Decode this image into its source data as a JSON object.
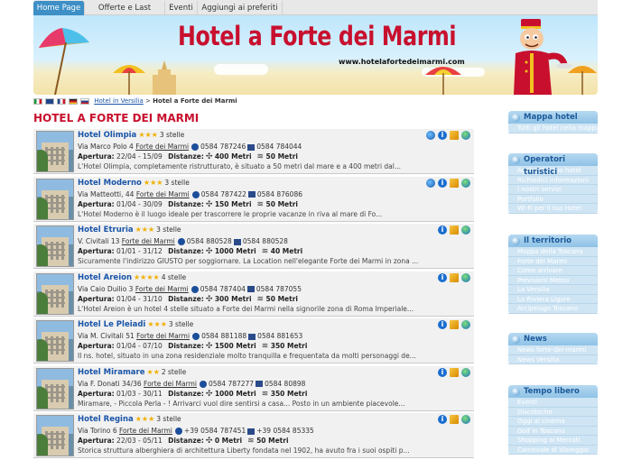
{
  "nav": {
    "tabs": [
      {
        "label": "Home Page"
      },
      {
        "label": "Offerte e Last Minute"
      },
      {
        "label": "Eventi"
      },
      {
        "label": "Aggiungi ai preferiti"
      }
    ]
  },
  "banner": {
    "title": "Hotel a Forte dei Marmi",
    "url": "www.hotelafortedeimarmi.com"
  },
  "breadcrumb": {
    "link": "Hotel in Versilia",
    "separator": ">",
    "current": "Hotel a Forte dei Marmi"
  },
  "page_title": "HOTEL A FORTE DEI MARMI",
  "labels": {
    "apertura": "Apertura:",
    "distanze": "Distanze:"
  },
  "hotels": [
    {
      "name": "Hotel Olimpia",
      "stars": "★★★",
      "stelle": "3 stelle",
      "address": "Via Marco Polo 4",
      "city": "Forte dei Marmi",
      "phone": "0584 787246",
      "fax": "0584 784044",
      "opening": "22/04 - 15/09",
      "dist_sea": "400 Metri",
      "dist_beach": "50 Metri",
      "desc": "L'Hotel Olimpia, completamente ristrutturato, è situato a 50 metri dal mare e a 400 metri dal..."
    },
    {
      "name": "Hotel Moderno",
      "stars": "★★★",
      "stelle": "3 stelle",
      "address": "Via Matteotti, 44",
      "city": "Forte dei Marmi",
      "phone": "0584 787422",
      "fax": "0584 876086",
      "opening": "01/04 - 30/09",
      "dist_sea": "150 Metri",
      "dist_beach": "50 Metri",
      "desc": "L'Hotel Moderno è il luogo ideale per trascorrere le proprie vacanze in riva al mare di Fo..."
    },
    {
      "name": "Hotel Etruria",
      "stars": "★★★",
      "stelle": "3 stelle",
      "address": "V. Civitali 13",
      "city": "Forte dei Marmi",
      "phone": "0584 880528",
      "fax": "0584 880528",
      "opening": "01/01 - 31/12",
      "dist_sea": "1000 Metri",
      "dist_beach": "40 Metri",
      "desc": "Sicuramente l'indirizzo GIUSTO per soggiornare. La Location nell'elegante Forte dei Marmi in zona ..."
    },
    {
      "name": "Hotel Areion",
      "stars": "★★★★",
      "stelle": "4 stelle",
      "address": "Via Caio Duilio 3",
      "city": "Forte dei Marmi",
      "phone": "0584 787404",
      "fax": "0584 787055",
      "opening": "01/04 - 31/10",
      "dist_sea": "300 Metri",
      "dist_beach": "50 Metri",
      "desc": "L'Hotel Areion è un hotel 4 stelle situato a Forte dei Marmi nella signorile zona di Roma Imperiale..."
    },
    {
      "name": "Hotel Le Pleiadi",
      "stars": "★★★",
      "stelle": "3 stelle",
      "address": "Via M. Civitali 51",
      "city": "Forte dei Marmi",
      "phone": "0584 881188",
      "fax": "0584 881653",
      "opening": "01/04 - 07/10",
      "dist_sea": "1500 Metri",
      "dist_beach": "350 Metri",
      "desc": "Il ns. hotel, situato in una zona residenziale molto tranquilla e frequentata da molti personaggi de..."
    },
    {
      "name": "Hotel Miramare",
      "stars": "★★",
      "stelle": "2 stelle",
      "address": "Via F. Donati 34/36",
      "city": "Forte dei Marmi",
      "phone": "0584 787277",
      "fax": "0584 80898",
      "opening": "01/03 - 30/11",
      "dist_sea": "1000 Metri",
      "dist_beach": "350 Metri",
      "desc": "Miramare, - Piccola Perla - ! Arrivarci vuol dire sentirsi a casa... Posto in un ambiente piacevole..."
    },
    {
      "name": "Hotel Regina",
      "stars": "★★★",
      "stelle": "3 stelle",
      "address": "Via Torino 6",
      "city": "Forte dei Marmi",
      "phone": "+39 0584 787451",
      "fax": "+39 0584 85335",
      "opening": "22/03 - 05/11",
      "dist_sea": "0 Metri",
      "dist_beach": "50 Metri",
      "desc": "Storica struttura alberghiera di architettura Liberty fondata nel 1902, ha avuto fra i suoi ospiti p..."
    }
  ],
  "sidebar": {
    "boxes": [
      {
        "title": "Mappa hotel",
        "items": [
          "Tutti gli hotel nella mappa"
        ]
      },
      {
        "title": "Operatori turistici",
        "items": [
          "Aggiungi il tuo hotel",
          "Richiedici informazioni",
          "I nostri servizi",
          "Portfolio",
          "Wi-Fi per il tuo Hotel"
        ]
      },
      {
        "title": "Il territorio",
        "items": [
          "Mappa della Toscana",
          "Forte dei Marmi",
          "Come arrivare",
          "Previsioni Meteo",
          "La Versilia",
          "La Riviera Ligure",
          "Arcipelago Toscano"
        ]
      },
      {
        "title": "News",
        "items": [
          "News forte-dei-marmi",
          "News Versilia"
        ]
      },
      {
        "title": "Tempo libero",
        "items": [
          "Eventi",
          "Discoteche",
          "Oggi al cinema",
          "Golf in Toscana",
          "Shopping ai Mercati",
          "Carnevale di Viareggio"
        ]
      }
    ]
  },
  "colors": {
    "brand_red": "#c8102e",
    "link_blue": "#1a55a8",
    "nav_active": "#3d8fc6",
    "sidebar_bg": "#cfe5f4"
  }
}
